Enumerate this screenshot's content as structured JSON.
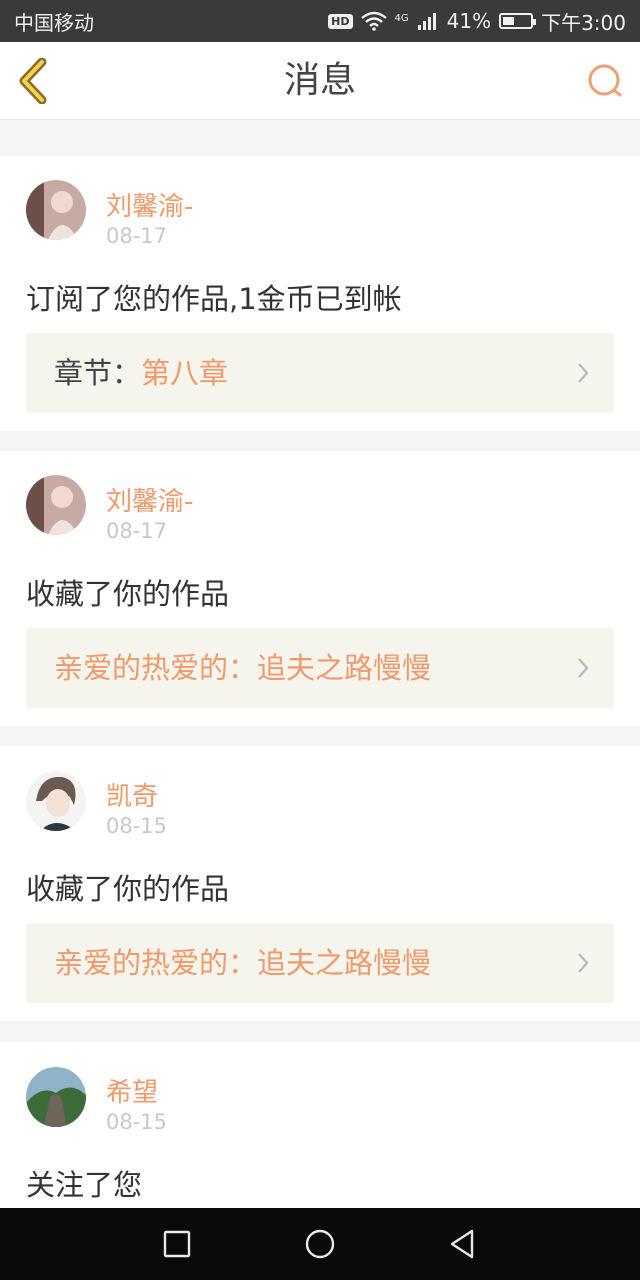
{
  "status_bar": {
    "carrier": "中国移动",
    "hd": "HD",
    "network": "4G",
    "battery": "41%",
    "battery_level": 0.41,
    "time": "下午3:00"
  },
  "header": {
    "title": "消息"
  },
  "messages": [
    {
      "user": "刘馨渝-",
      "date": "08-17",
      "action": "订阅了您的作品,1金币已到帐",
      "ref_label": "章节：",
      "ref_value": "第八章"
    },
    {
      "user": "刘馨渝-",
      "date": "08-17",
      "action": "收藏了你的作品",
      "ref_value": "亲爱的热爱的：追夫之路慢慢"
    },
    {
      "user": "凯奇",
      "date": "08-15",
      "action": "收藏了你的作品",
      "ref_value": "亲爱的热爱的：追夫之路慢慢"
    },
    {
      "user": "希望",
      "date": "08-15",
      "action": "关注了您"
    }
  ],
  "colors": {
    "accent": "#f0996a",
    "background": "#f5f5f5",
    "ref_box": "#f5f5ee",
    "status_bar": "#3a3a3a"
  }
}
